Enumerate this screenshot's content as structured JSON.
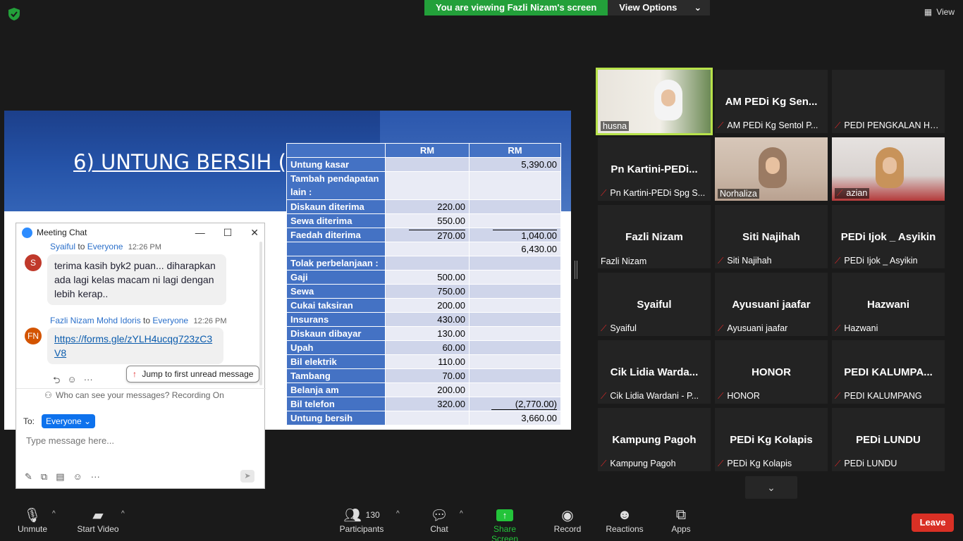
{
  "banner": {
    "viewing": "You are viewing Fazli Nizam's screen",
    "options": "View Options"
  },
  "view_button": "View",
  "slide": {
    "title": "6) UNTUNG BERSIH (sa",
    "headers": [
      "",
      "RM",
      "RM"
    ],
    "rows": [
      {
        "label": "Untung kasar",
        "a": "",
        "b": "5,390.00"
      },
      {
        "label": "Tambah pendapatan lain :",
        "a": "",
        "b": ""
      },
      {
        "label": "Diskaun diterima",
        "a": "220.00",
        "b": ""
      },
      {
        "label": "Sewa diterima",
        "a": "550.00",
        "b": ""
      },
      {
        "label": "Faedah diterima",
        "a": "270.00",
        "b": "1,040.00"
      },
      {
        "label": "",
        "a": "",
        "b": "6,430.00"
      },
      {
        "label": "Tolak perbelanjaan :",
        "a": "",
        "b": ""
      },
      {
        "label": "Gaji",
        "a": "500.00",
        "b": ""
      },
      {
        "label": "Sewa",
        "a": "750.00",
        "b": ""
      },
      {
        "label": "Cukai taksiran",
        "a": "200.00",
        "b": ""
      },
      {
        "label": "Insurans",
        "a": "430.00",
        "b": ""
      },
      {
        "label": "Diskaun dibayar",
        "a": "130.00",
        "b": ""
      },
      {
        "label": "Upah",
        "a": "60.00",
        "b": ""
      },
      {
        "label": "Bil elektrik",
        "a": "110.00",
        "b": ""
      },
      {
        "label": "Tambang",
        "a": "70.00",
        "b": ""
      },
      {
        "label": "Belanja am",
        "a": "200.00",
        "b": ""
      },
      {
        "label": "Bil telefon",
        "a": "320.00",
        "b": "(2,770.00)"
      },
      {
        "label": "Untung bersih",
        "a": "",
        "b": "3,660.00"
      }
    ]
  },
  "chat": {
    "title": "Meeting Chat",
    "messages": [
      {
        "avatar": "S",
        "avatar_color": "#c0392b",
        "sender": "Syaiful",
        "to_word": "to",
        "to": "Everyone",
        "time": "12:26 PM",
        "text": "terima kasih byk2 puan... diharapkan ada lagi kelas macam ni lagi dengan lebih kerap.."
      },
      {
        "avatar": "FN",
        "avatar_color": "#d35400",
        "sender": "Fazli Nizam Mohd Idoris",
        "to_word": "to",
        "to": "Everyone",
        "time": "12:26 PM",
        "text": "https://forms.gle/zYLH4ucqg723zC3V8"
      }
    ],
    "jump_label": "Jump to first unread message",
    "who_can_see": "Who can see your messages? Recording On",
    "to_label": "To:",
    "to_value": "Everyone",
    "input_placeholder": "Type message here..."
  },
  "gallery": [
    {
      "big": "",
      "label": "husna",
      "muted": false,
      "photo": true,
      "active": true
    },
    {
      "big": "AM PEDi Kg Sen...",
      "label": "AM PEDi Kg Sentol P...",
      "muted": true
    },
    {
      "big": "",
      "label": "PEDI PENGKALAN HU...",
      "muted": true
    },
    {
      "big": "Pn Kartini-PEDi...",
      "label": "Pn Kartini-PEDi Spg S...",
      "muted": true
    },
    {
      "big": "",
      "label": "Norhaliza",
      "muted": false,
      "photo": true
    },
    {
      "big": "",
      "label": "azian",
      "muted": true,
      "photo": true
    },
    {
      "big": "Fazli Nizam",
      "label": "Fazli Nizam",
      "muted": false
    },
    {
      "big": "Siti Najihah",
      "label": "Siti Najihah",
      "muted": true
    },
    {
      "big": "PEDi Ijok _ Asyikin",
      "label": "PEDi Ijok _ Asyikin",
      "muted": true
    },
    {
      "big": "Syaiful",
      "label": "Syaiful",
      "muted": true
    },
    {
      "big": "Ayusuani jaafar",
      "label": "Ayusuani jaafar",
      "muted": true
    },
    {
      "big": "Hazwani",
      "label": "Hazwani",
      "muted": true
    },
    {
      "big": "Cik Lidia Warda...",
      "label": "Cik Lidia Wardani - P...",
      "muted": true
    },
    {
      "big": "HONOR",
      "label": "HONOR",
      "muted": true
    },
    {
      "big": "PEDI KALUMPA...",
      "label": "PEDI KALUMPANG",
      "muted": true
    },
    {
      "big": "Kampung Pagoh",
      "label": "Kampung Pagoh",
      "muted": true
    },
    {
      "big": "PEDi Kg Kolapis",
      "label": "PEDi Kg Kolapis",
      "muted": true
    },
    {
      "big": "PEDi LUNDU",
      "label": "PEDi LUNDU",
      "muted": true
    }
  ],
  "toolbar": {
    "unmute": "Unmute",
    "start_video": "Start Video",
    "participants": "Participants",
    "participants_count": "130",
    "chat": "Chat",
    "share_screen": "Share Screen",
    "record": "Record",
    "reactions": "Reactions",
    "apps": "Apps",
    "leave": "Leave"
  },
  "colors": {
    "share_green": "#23a03a",
    "leave_red": "#d93025",
    "slide_blue": "#4472c4",
    "active_speaker": "#b7e24a"
  }
}
